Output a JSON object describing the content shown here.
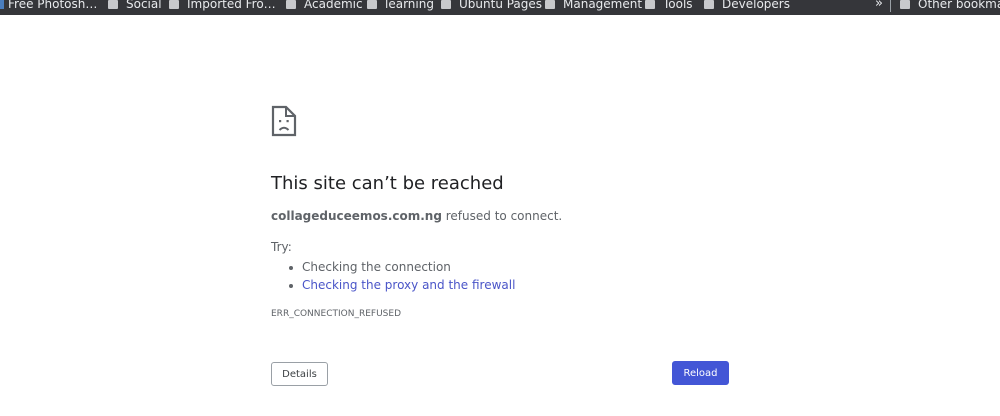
{
  "bookmarks_bar": {
    "items": [
      {
        "label": "Free Photosh…",
        "icon": "favicon-icon"
      },
      {
        "label": "Social",
        "icon": "folder-icon"
      },
      {
        "label": "Imported Fro…",
        "icon": "folder-icon"
      },
      {
        "label": "Academic",
        "icon": "folder-icon"
      },
      {
        "label": "learning",
        "icon": "folder-icon"
      },
      {
        "label": "Ubuntu Pages",
        "icon": "folder-icon"
      },
      {
        "label": "Management",
        "icon": "folder-icon"
      },
      {
        "label": "Tools",
        "icon": "folder-icon"
      },
      {
        "label": "Developers",
        "icon": "folder-icon"
      }
    ],
    "overflow_label": "»",
    "other_bookmarks_label": "Other bookmarks"
  },
  "error_page": {
    "icon": "sad-document-icon",
    "title": "This site can’t be reached",
    "host": "collageduceemos.com.ng",
    "summary_suffix": " refused to connect.",
    "try_label": "Try:",
    "suggestions": [
      {
        "label": "Checking the connection",
        "is_link": false
      },
      {
        "label": "Checking the proxy and the firewall",
        "is_link": true
      }
    ],
    "error_code": "ERR_CONNECTION_REFUSED",
    "details_button": "Details",
    "reload_button": "Reload"
  },
  "colors": {
    "bookmarks_bar_bg": "#35363a",
    "link": "#4a55c8",
    "primary_button": "#4356d6",
    "text": "#5f6368",
    "title": "#202124"
  }
}
